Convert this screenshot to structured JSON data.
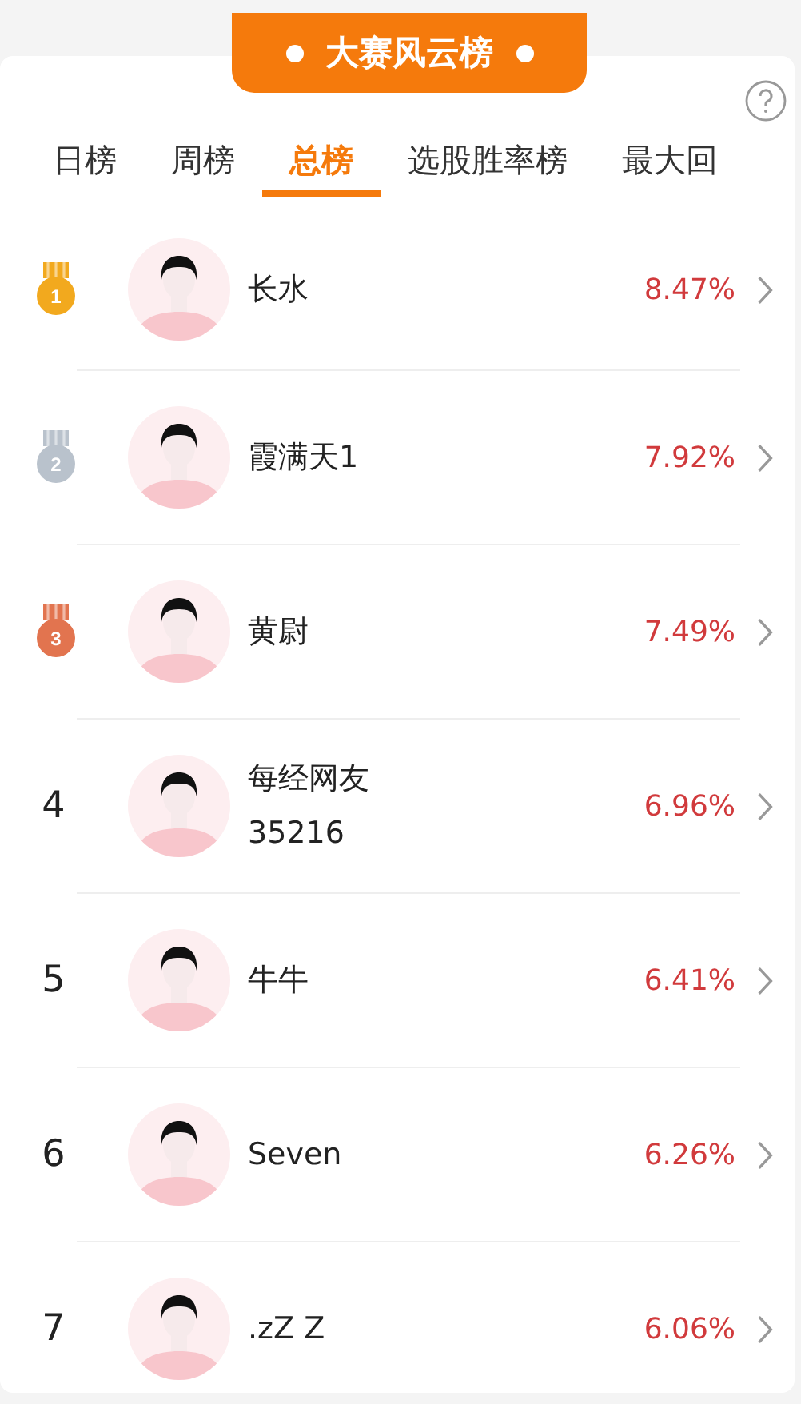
{
  "banner": {
    "title": "大赛风云榜"
  },
  "tabs": [
    {
      "label": "日榜",
      "selected": false
    },
    {
      "label": "周榜",
      "selected": false
    },
    {
      "label": "总榜",
      "selected": true
    },
    {
      "label": "选股胜率榜",
      "selected": false
    },
    {
      "label": "最大回",
      "selected": false
    }
  ],
  "rows": [
    {
      "rank": "1",
      "kind": "medal",
      "color": "#f2a91e",
      "name": "长水",
      "return": "8.47%"
    },
    {
      "rank": "2",
      "kind": "medal",
      "color": "#b9c2cc",
      "name": "霞满天1",
      "return": "7.92%"
    },
    {
      "rank": "3",
      "kind": "medal",
      "color": "#e2744f",
      "name": "黄尉",
      "return": "7.49%"
    },
    {
      "rank": "4",
      "kind": "number",
      "name": "每经网友35216",
      "return": "6.96%"
    },
    {
      "rank": "5",
      "kind": "number",
      "name": "牛牛",
      "return": "6.41%"
    },
    {
      "rank": "6",
      "kind": "number",
      "name": "Seven",
      "return": "6.26%"
    },
    {
      "rank": "7",
      "kind": "number",
      "name": ".zZ Z",
      "return": "6.06%"
    }
  ]
}
